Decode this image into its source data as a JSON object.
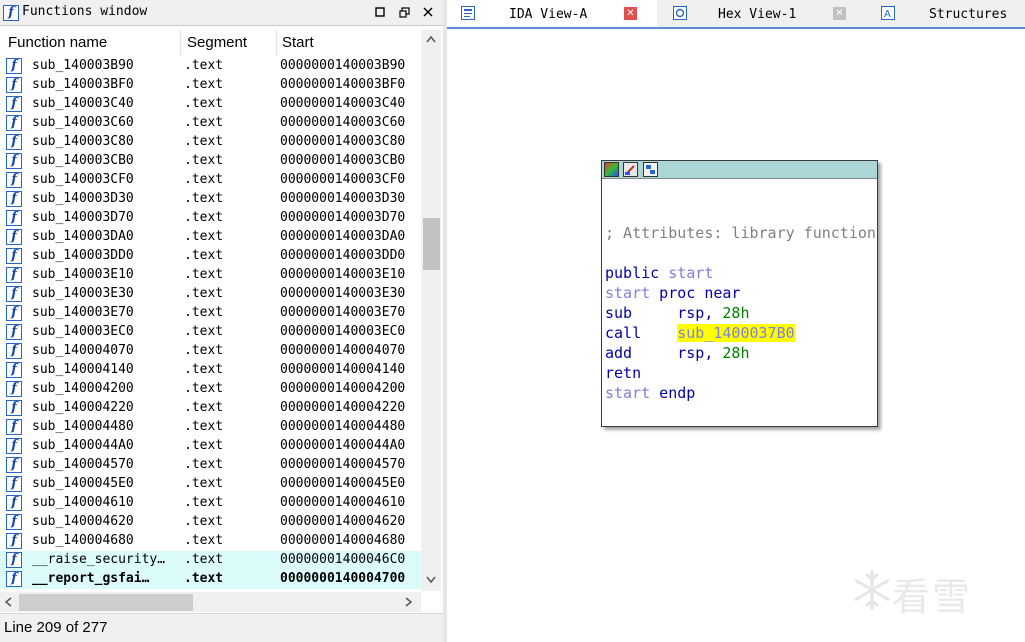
{
  "functions_window": {
    "title": "Functions window",
    "columns": [
      "Function name",
      "Segment",
      "Start"
    ],
    "rows": [
      {
        "name": "sub_140003B90",
        "segment": ".text",
        "start": "0000000140003B90"
      },
      {
        "name": "sub_140003BF0",
        "segment": ".text",
        "start": "0000000140003BF0"
      },
      {
        "name": "sub_140003C40",
        "segment": ".text",
        "start": "0000000140003C40"
      },
      {
        "name": "sub_140003C60",
        "segment": ".text",
        "start": "0000000140003C60"
      },
      {
        "name": "sub_140003C80",
        "segment": ".text",
        "start": "0000000140003C80"
      },
      {
        "name": "sub_140003CB0",
        "segment": ".text",
        "start": "0000000140003CB0"
      },
      {
        "name": "sub_140003CF0",
        "segment": ".text",
        "start": "0000000140003CF0"
      },
      {
        "name": "sub_140003D30",
        "segment": ".text",
        "start": "0000000140003D30"
      },
      {
        "name": "sub_140003D70",
        "segment": ".text",
        "start": "0000000140003D70"
      },
      {
        "name": "sub_140003DA0",
        "segment": ".text",
        "start": "0000000140003DA0"
      },
      {
        "name": "sub_140003DD0",
        "segment": ".text",
        "start": "0000000140003DD0"
      },
      {
        "name": "sub_140003E10",
        "segment": ".text",
        "start": "0000000140003E10"
      },
      {
        "name": "sub_140003E30",
        "segment": ".text",
        "start": "0000000140003E30"
      },
      {
        "name": "sub_140003E70",
        "segment": ".text",
        "start": "0000000140003E70"
      },
      {
        "name": "sub_140003EC0",
        "segment": ".text",
        "start": "0000000140003EC0"
      },
      {
        "name": "sub_140004070",
        "segment": ".text",
        "start": "0000000140004070"
      },
      {
        "name": "sub_140004140",
        "segment": ".text",
        "start": "0000000140004140"
      },
      {
        "name": "sub_140004200",
        "segment": ".text",
        "start": "0000000140004200"
      },
      {
        "name": "sub_140004220",
        "segment": ".text",
        "start": "0000000140004220"
      },
      {
        "name": "sub_140004480",
        "segment": ".text",
        "start": "0000000140004480"
      },
      {
        "name": "sub_1400044A0",
        "segment": ".text",
        "start": "00000001400044A0"
      },
      {
        "name": "sub_140004570",
        "segment": ".text",
        "start": "0000000140004570"
      },
      {
        "name": "sub_1400045E0",
        "segment": ".text",
        "start": "00000001400045E0"
      },
      {
        "name": "sub_140004610",
        "segment": ".text",
        "start": "0000000140004610"
      },
      {
        "name": "sub_140004620",
        "segment": ".text",
        "start": "0000000140004620"
      },
      {
        "name": "sub_140004680",
        "segment": ".text",
        "start": "0000000140004680"
      },
      {
        "name": "__raise_security…",
        "segment": ".text",
        "start": "00000001400046C0",
        "highlight": true
      },
      {
        "name": "__report_gsfai…",
        "segment": ".text",
        "start": "0000000140004700",
        "highlight": true,
        "bold": true
      }
    ],
    "status": "Line 209 of 277"
  },
  "tabs": [
    {
      "label": "IDA View-A",
      "active": true,
      "close_color": "#e05050"
    },
    {
      "label": "Hex View-1",
      "active": false,
      "close_color": "#c0c0c0"
    },
    {
      "label": "Structures",
      "active": false
    }
  ],
  "graph_node": {
    "lines": [
      {
        "parts": [
          {
            "t": "; Attributes: library function",
            "c": "cm"
          }
        ]
      },
      {
        "parts": []
      },
      {
        "parts": [
          {
            "t": "public ",
            "c": "kw"
          },
          {
            "t": "start",
            "c": "nm"
          }
        ]
      },
      {
        "parts": [
          {
            "t": "start",
            "c": "nm"
          },
          {
            "t": " proc near",
            "c": "kw"
          }
        ]
      },
      {
        "parts": [
          {
            "t": "sub     ",
            "c": "kw"
          },
          {
            "t": "rsp, ",
            "c": "kw"
          },
          {
            "t": "28h",
            "c": "nu"
          }
        ]
      },
      {
        "parts": [
          {
            "t": "call    ",
            "c": "kw"
          },
          {
            "t": "sub_1400037B0",
            "c": "hlsym"
          }
        ]
      },
      {
        "parts": [
          {
            "t": "add     ",
            "c": "kw"
          },
          {
            "t": "rsp, ",
            "c": "kw"
          },
          {
            "t": "28h",
            "c": "nu"
          }
        ]
      },
      {
        "parts": [
          {
            "t": "retn",
            "c": "kw"
          }
        ]
      },
      {
        "parts": [
          {
            "t": "start",
            "c": "nm"
          },
          {
            "t": " endp",
            "c": "kw"
          }
        ]
      }
    ]
  },
  "watermark": {
    "text": "看雪",
    "icon": "snowflake-icon"
  },
  "icons": {
    "function": "function-icon",
    "minimize": "minimize-icon",
    "restore": "restore-icon",
    "close": "close-icon"
  },
  "scroll": {
    "vertical_position": 0.36
  }
}
